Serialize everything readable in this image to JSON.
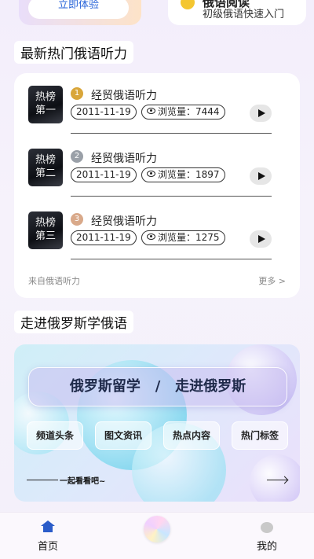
{
  "top": {
    "try_button": "立即体验",
    "card_title": "俄语阅读",
    "card_subtitle": "初级俄语快速入门"
  },
  "section1": {
    "title": "最新热门俄语听力"
  },
  "listening": {
    "items": [
      {
        "thumb_line1": "热榜",
        "thumb_line2": "第一",
        "rank": "1",
        "title": "经贸俄语听力",
        "date": "2011-11-19",
        "views": "浏览量：7444"
      },
      {
        "thumb_line1": "热榜",
        "thumb_line2": "第二",
        "rank": "2",
        "title": "经贸俄语听力",
        "date": "2011-11-19",
        "views": "浏览量：1897"
      },
      {
        "thumb_line1": "热榜",
        "thumb_line2": "第三",
        "rank": "3",
        "title": "经贸俄语听力",
        "date": "2011-11-19",
        "views": "浏览量：1275"
      }
    ],
    "source": "来自俄语听力",
    "more": "更多 >"
  },
  "section2": {
    "title": "走进俄罗斯学俄语"
  },
  "banner": {
    "headline": "俄罗斯留学   /   走进俄罗斯",
    "chips": [
      "频道头条",
      "图文资讯",
      "热点内容",
      "热门标签"
    ],
    "caption": "一起看看吧~"
  },
  "tabbar": {
    "home": "首页",
    "mine": "我的"
  }
}
